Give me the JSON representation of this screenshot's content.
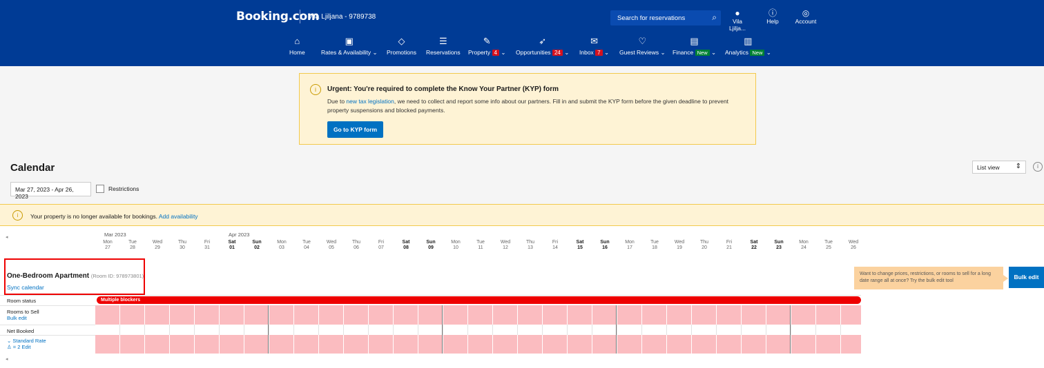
{
  "header": {
    "brand": "Booking.com",
    "property": "Vila Ljiljana - 9789738",
    "search_placeholder": "Search for reservations",
    "user_label": "Vila Ljilja...",
    "help_label": "Help",
    "account_label": "Account"
  },
  "nav": {
    "home": "Home",
    "rates": "Rates & Availability ⌄",
    "promotions": "Promotions",
    "reservations": "Reservations",
    "property": "Property",
    "property_badge": "4",
    "opportunities": "Opportunities",
    "opportunities_badge": "24",
    "inbox": "Inbox",
    "inbox_badge": "7",
    "guest_reviews": "Guest Reviews ⌄",
    "finance": "Finance",
    "finance_badge": "New",
    "analytics": "Analytics",
    "analytics_badge": "New"
  },
  "kyp": {
    "title": "Urgent: You're required to complete the Know Your Partner (KYP) form",
    "body_pre": "Due to ",
    "body_link": "new tax legislation",
    "body_post": ", we need to collect and report some info about our partners. Fill in and submit the KYP form before the given deadline to prevent property suspensions and blocked payments.",
    "button": "Go to KYP form"
  },
  "calendar": {
    "title": "Calendar",
    "date_range": "Mar 27, 2023 - Apr 26, 2023",
    "restrictions_label": "Restrictions",
    "view_select": "List view"
  },
  "availability_notice": {
    "text": "Your property is no longer available for bookings. ",
    "link": "Add availability"
  },
  "months": [
    "Mar 2023",
    "Apr 2023"
  ],
  "days": [
    {
      "dow": "Mon",
      "d": "27"
    },
    {
      "dow": "Tue",
      "d": "28"
    },
    {
      "dow": "Wed",
      "d": "29"
    },
    {
      "dow": "Thu",
      "d": "30"
    },
    {
      "dow": "Fri",
      "d": "31"
    },
    {
      "dow": "Sat",
      "d": "01"
    },
    {
      "dow": "Sun",
      "d": "02"
    },
    {
      "dow": "Mon",
      "d": "03"
    },
    {
      "dow": "Tue",
      "d": "04"
    },
    {
      "dow": "Wed",
      "d": "05"
    },
    {
      "dow": "Thu",
      "d": "06"
    },
    {
      "dow": "Fri",
      "d": "07"
    },
    {
      "dow": "Sat",
      "d": "08"
    },
    {
      "dow": "Sun",
      "d": "09"
    },
    {
      "dow": "Mon",
      "d": "10"
    },
    {
      "dow": "Tue",
      "d": "11"
    },
    {
      "dow": "Wed",
      "d": "12"
    },
    {
      "dow": "Thu",
      "d": "13"
    },
    {
      "dow": "Fri",
      "d": "14"
    },
    {
      "dow": "Sat",
      "d": "15"
    },
    {
      "dow": "Sun",
      "d": "16"
    },
    {
      "dow": "Mon",
      "d": "17"
    },
    {
      "dow": "Tue",
      "d": "18"
    },
    {
      "dow": "Wed",
      "d": "19"
    },
    {
      "dow": "Thu",
      "d": "20"
    },
    {
      "dow": "Fri",
      "d": "21"
    },
    {
      "dow": "Sat",
      "d": "22"
    },
    {
      "dow": "Sun",
      "d": "23"
    },
    {
      "dow": "Mon",
      "d": "24"
    },
    {
      "dow": "Tue",
      "d": "25"
    },
    {
      "dow": "Wed",
      "d": "26"
    }
  ],
  "room": {
    "name": "One-Bedroom Apartment",
    "id_text": "(Room ID: 978973801)",
    "sync": "Sync calendar",
    "status_label": "Room status",
    "blocker": "Multiple blockers",
    "rooms_to_sell": "Rooms to Sell",
    "bulk_edit_link": "Bulk edit",
    "net_booked": "Net Booked",
    "rate": "⌄ Standard Rate",
    "rate_sub": "♙ = 2  Edit"
  },
  "bulk": {
    "tip": "Want to change prices, restrictions, or rooms to sell for a long date range all at once? Try the bulk edit tool",
    "button": "Bulk edit"
  }
}
